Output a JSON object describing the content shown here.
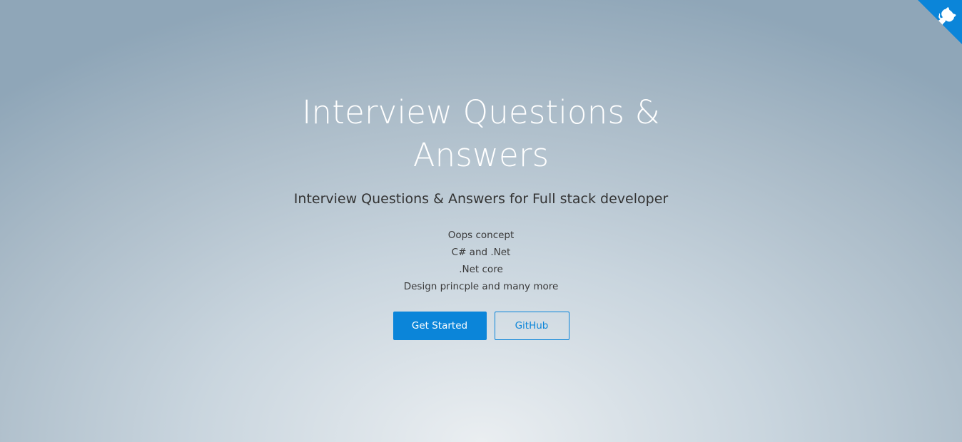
{
  "cover": {
    "title": "Interview Questions & Answers",
    "tagline": "Interview Questions & Answers for Full stack developer",
    "topics": [
      "Oops concept",
      "C# and .Net",
      ".Net core",
      "Design princple and many more"
    ],
    "buttons": {
      "primary": "Get Started",
      "secondary": "GitHub"
    }
  },
  "colors": {
    "accent": "#0b85d9",
    "title": "#ffffff"
  },
  "corner": {
    "icon": "github-octocat-icon"
  }
}
